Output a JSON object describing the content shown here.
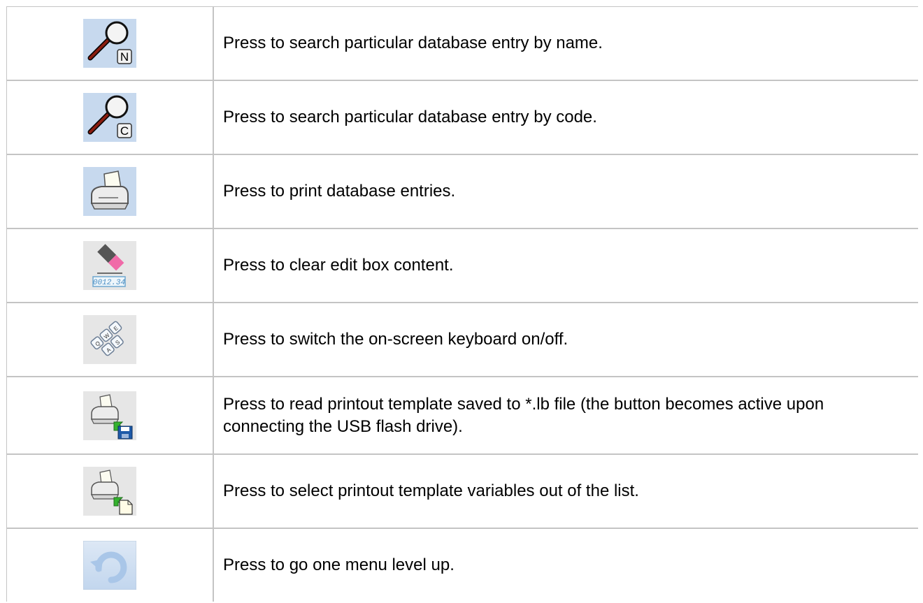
{
  "rows": [
    {
      "icon": "search-by-name-icon",
      "key_letter": "N",
      "description": "Press to search particular database entry by name."
    },
    {
      "icon": "search-by-code-icon",
      "key_letter": "C",
      "description": "Press to search particular database entry by code."
    },
    {
      "icon": "printer-icon",
      "description": "Press to print database entries."
    },
    {
      "icon": "clear-edit-box-icon",
      "display_value": "0012.34",
      "description": "Press to clear edit box content."
    },
    {
      "icon": "on-screen-keyboard-icon",
      "keys": [
        "Q",
        "W",
        "E",
        "A",
        "S"
      ],
      "description": "Press to switch the on-screen keyboard on/off."
    },
    {
      "icon": "read-template-from-usb-icon",
      "description": "Press to read printout template saved to *.lb file (the button becomes active upon connecting the USB flash drive)."
    },
    {
      "icon": "select-template-variables-icon",
      "description": "Press to select printout template variables out of the list."
    },
    {
      "icon": "menu-level-up-icon",
      "description": "Press to go one menu level up."
    }
  ],
  "colors": {
    "border": "#c4c4c4",
    "button_blue": "#c7d9ee",
    "button_grey": "#e6e6e6"
  }
}
